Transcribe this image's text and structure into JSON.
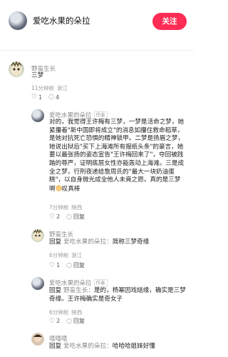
{
  "header": {
    "author": "爱吃水果的朵拉",
    "follow_label": "关注"
  },
  "comments": [
    {
      "user": "野蛮生长",
      "text": "三梦",
      "time": "11分钟前",
      "location": "浙江",
      "likes": "1",
      "replies": "4"
    },
    {
      "user": "爱吃水果的朵拉",
      "tag": "作者",
      "text": "对的，我觉得王许梅有三梦，一梦是活命之梦，她紧攥着\"新中国即将成立\"的消息如攥住救命稻草，是她对抗死亡恐惧的精神锁甲。二梦是扬眉之梦，她说出狱后\"买下上海滩所有报纸头条\"的豪言，她要以最张扬的姿态宣告\"王许梅回来了\"，夺回被践踏的尊严，证明底层女性亦能轰动上海滩。三是成全之梦，行刑夜递给詹周氏的\"最大一块奶油蛋糕\"，以自身微光成全他人未竟之愿。真的是三梦啊",
      "text_tail": "叹真棒",
      "time": "7分钟前",
      "location": "陕西",
      "likes": "2",
      "reply_label": "回复"
    },
    {
      "user": "野蛮生长",
      "reply_prefix": "回复",
      "reply_to": "爱吃水果的朵拉",
      "text": "简称三梦奇缘",
      "time": "6分钟前",
      "location": "浙江",
      "likes": "1",
      "reply_label": "回复"
    },
    {
      "user": "爱吃水果的朵拉",
      "tag": "作者",
      "reply_prefix": "回复",
      "reply_to": "野蛮生长",
      "text": "是的，杨幂因戏结缘，确实是三梦奇缘。王许梅确实是奇女子",
      "time": "6分钟前",
      "location": "陕西",
      "likes": "2",
      "reply_label": "回复"
    },
    {
      "user": "嘻嘻嘻",
      "reply_prefix": "回复",
      "reply_to": "爱吃水果的朵拉",
      "text": "哈哈哈姐妹好懂",
      "time": "",
      "location": ""
    }
  ]
}
